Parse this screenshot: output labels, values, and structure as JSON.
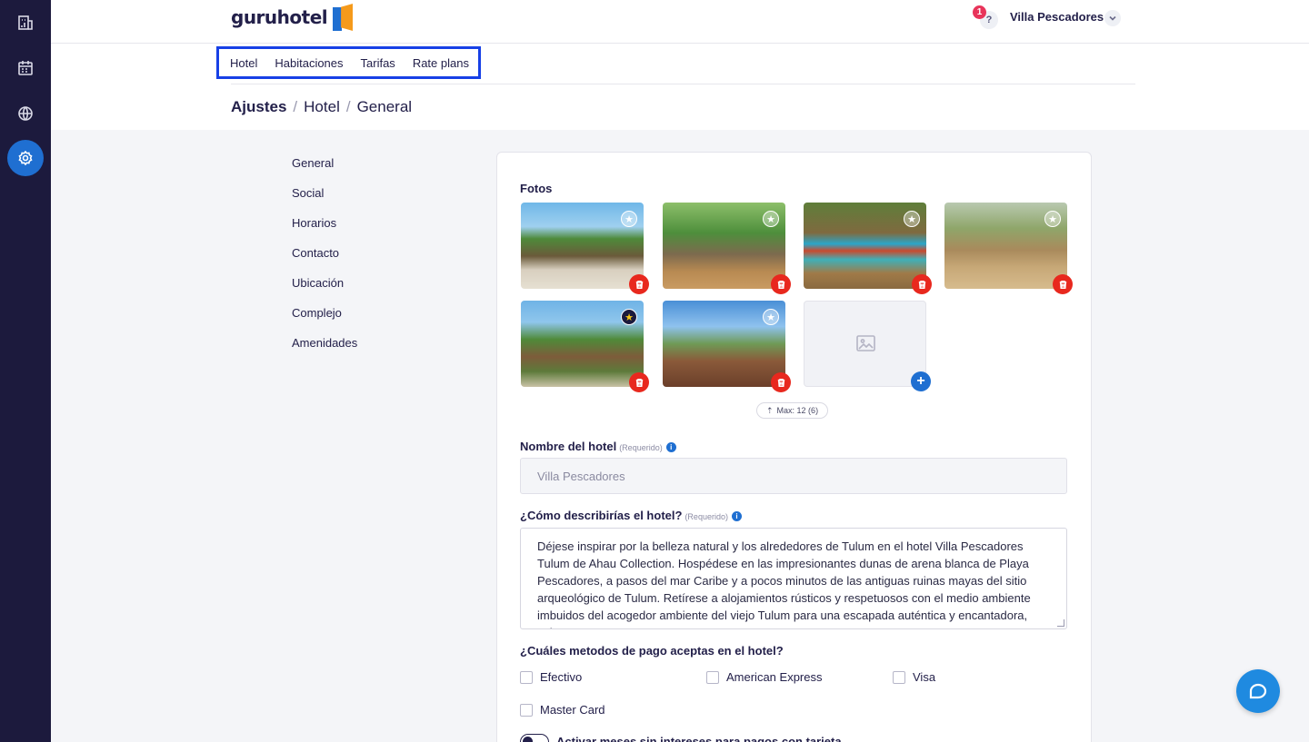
{
  "brand": {
    "name": "guruhotel"
  },
  "header": {
    "help_badge": "1",
    "help_symbol": "?",
    "user_name": "Villa Pescadores"
  },
  "tabs": [
    {
      "label": "Hotel"
    },
    {
      "label": "Habitaciones"
    },
    {
      "label": "Tarifas"
    },
    {
      "label": "Rate plans"
    }
  ],
  "breadcrumb": {
    "root": "Ajustes",
    "sep": "/",
    "section": "Hotel",
    "page": "General"
  },
  "settings_menu": [
    {
      "label": "General"
    },
    {
      "label": "Social"
    },
    {
      "label": "Horarios"
    },
    {
      "label": "Contacto"
    },
    {
      "label": "Ubicación"
    },
    {
      "label": "Complejo"
    },
    {
      "label": "Amenidades"
    }
  ],
  "photos": {
    "label": "Fotos",
    "max_label": "Max: 12 (6)",
    "featured_index": 4
  },
  "hotel_name": {
    "label": "Nombre del hotel",
    "required": "(Requerido)",
    "value": "Villa Pescadores"
  },
  "description": {
    "label": "¿Cómo describirías el hotel?",
    "required": "(Requerido)",
    "value": "Déjese inspirar por la belleza natural y los alrededores de Tulum en el hotel Villa Pescadores Tulum de Ahau Collection. Hospédese en las impresionantes dunas de arena blanca de Playa Pescadores, a pasos del mar Caribe y a pocos minutos de las antiguas ruinas mayas del sitio arqueológico de Tulum. Retírese a alojamientos rústicos y respetuosos con el medio ambiente imbuidos del acogedor ambiente del viejo Tulum para una escapada auténtica y encantadora, solo"
  },
  "payment": {
    "label": "¿Cuáles metodos de pago aceptas en el hotel?",
    "options": [
      {
        "label": "Efectivo"
      },
      {
        "label": "American Express"
      },
      {
        "label": "Visa"
      },
      {
        "label": "Master Card"
      }
    ],
    "msi_toggle_label": "Activar meses sin intereses para pagos con tarjeta"
  },
  "colors": {
    "sidebar": "#1c1a3d",
    "accent": "#1f6fd1",
    "danger": "#e8281e",
    "highlight_border": "#1740e6"
  }
}
